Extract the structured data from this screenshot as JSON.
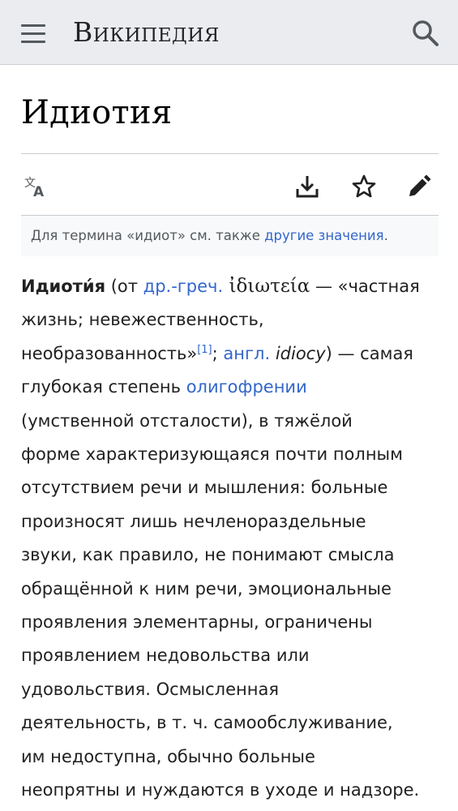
{
  "header": {
    "logo": "Википедия",
    "menu_icon": "hamburger-menu-icon",
    "search_icon": "search-icon"
  },
  "article": {
    "title": "Идиотия",
    "actions": {
      "language": "translate-language-icon",
      "download": "download-icon",
      "watch": "star-icon",
      "edit": "edit-pencil-icon"
    },
    "hatnote": {
      "prefix": "Для термина «идиот» см. также ",
      "link": "другие значения",
      "suffix": "."
    },
    "body": {
      "term": "Идиоти́я",
      "l1_a": " (от ",
      "l1_link": "др.-греч.",
      "l1_greek": " ἰδιωτεία",
      "l1_b": " — «частная",
      "l2": "жизнь; невежественность,",
      "l3_a": "необразованность»",
      "l3_ref": "[1]",
      "l3_b": "; ",
      "l3_link": "англ.",
      "l3_italic": " idiocy",
      "l3_c": ") — самая",
      "l4_a": "глубокая степень ",
      "l4_link": "олигофрении",
      "l5": "(умственной отсталости), в тяжёлой",
      "l6": "форме характеризующаяся почти полным",
      "l7": "отсутствием речи и мышления: больные",
      "l8": "произносят лишь нечленораздельные",
      "l9": "звуки, как правило, не понимают смысла",
      "l10": "обращённой к ним речи, эмоциональные",
      "l11": "проявления элементарны, ограничены",
      "l12": "проявлением недовольства или",
      "l13": "удовольствия. Осмысленная",
      "l14": "деятельность, в т. ч. самообслуживание,",
      "l15": "им недоступна, обычно больные",
      "l16": "неопрятны и нуждаются в уходе и надзоре."
    }
  },
  "colors": {
    "header_bg": "#eaecf0",
    "link": "#3366cc",
    "text": "#202122",
    "icon": "#54595d"
  }
}
